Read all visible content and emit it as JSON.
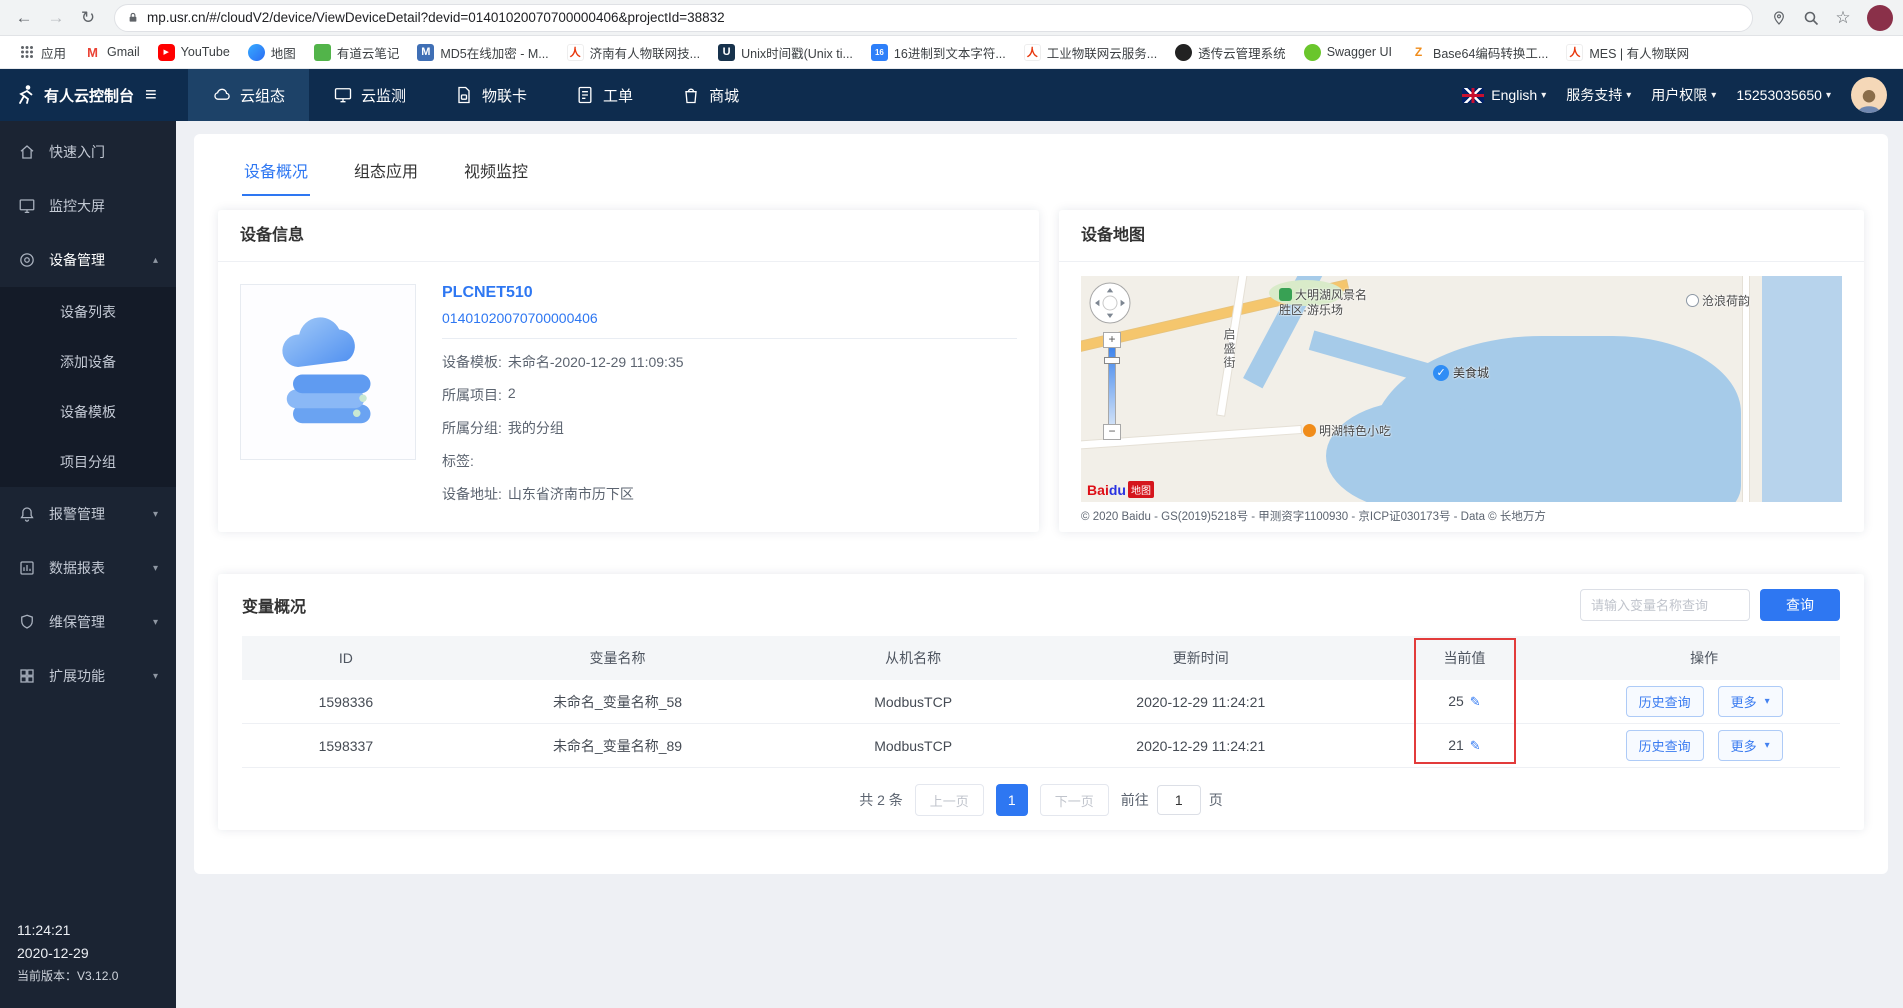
{
  "colors": {
    "accent": "#2e77f2",
    "nav_bg": "#0e2c4e",
    "sidebar_bg": "#1b2433",
    "highlight_red": "#e23b3b",
    "brand_red": "#e8380d"
  },
  "icons": {
    "back": "←",
    "forward": "→",
    "reload": "↻",
    "star": "☆",
    "hamburger": "≡",
    "caret_down": "▾",
    "caret_up": "▴",
    "edit": "✎",
    "check": "✓",
    "zoom_in": "+",
    "zoom_out": "−"
  },
  "browser": {
    "url": "mp.usr.cn/#/cloudV2/device/ViewDeviceDetail?devid=01401020070700000406&projectId=38832",
    "bookmarks": [
      "应用",
      "Gmail",
      "YouTube",
      "地图",
      "有道云笔记",
      "MD5在线加密 - M...",
      "济南有人物联网技...",
      "Unix时间戳(Unix ti...",
      "16进制到文本字符...",
      "工业物联网云服务...",
      "透传云管理系统",
      "Swagger UI",
      "Base64编码转换工...",
      "MES | 有人物联网"
    ],
    "favicon_glyphs": {
      "gmail": "M",
      "play": "▶",
      "md5": "M",
      "person": "人",
      "unix": "U",
      "hex": "16",
      "base64": "Z"
    }
  },
  "topnav": {
    "brand": "有人云控制台",
    "items": [
      {
        "label": "云组态"
      },
      {
        "label": "云监测"
      },
      {
        "label": "物联卡"
      },
      {
        "label": "工单"
      },
      {
        "label": "商城"
      }
    ],
    "language": "English",
    "support": "服务支持",
    "permission": "用户权限",
    "account": "15253035650"
  },
  "sidebar": {
    "items": [
      {
        "label": "快速入门"
      },
      {
        "label": "监控大屏"
      },
      {
        "label": "设备管理"
      },
      {
        "label": "报警管理"
      },
      {
        "label": "数据报表"
      },
      {
        "label": "维保管理"
      },
      {
        "label": "扩展功能"
      }
    ],
    "submenu": [
      "设备列表",
      "添加设备",
      "设备模板",
      "项目分组"
    ],
    "footer": {
      "time": "11:24:21",
      "date": "2020-12-29",
      "version_label": "当前版本：",
      "version": "V3.12.0"
    }
  },
  "main": {
    "tabs": [
      "设备概况",
      "组态应用",
      "视频监控"
    ],
    "device_info": {
      "title": "设备信息",
      "name": "PLCNET510",
      "device_id": "01401020070700000406",
      "fields": [
        {
          "label": "设备模板:",
          "value": "未命名-2020-12-29 11:09:35"
        },
        {
          "label": "所属项目:",
          "value": "2"
        },
        {
          "label": "所属分组:",
          "value": "我的分组"
        },
        {
          "label": "标签:",
          "value": ""
        },
        {
          "label": "设备地址:",
          "value": "山东省济南市历下区"
        }
      ]
    },
    "device_map": {
      "title": "设备地图",
      "pois": {
        "park": "大明湖风景名胜区·游乐场",
        "street": "启盛街",
        "snack": "明湖特色小吃",
        "marker": "美食城",
        "lotus": "沧浪荷韵"
      },
      "logo": {
        "bai": "Bai",
        "du": "du",
        "badge": "地图"
      },
      "copyright": "© 2020 Baidu - GS(2019)5218号 - 甲测资字1100930 - 京ICP证030173号 - Data © 长地万方"
    },
    "variables": {
      "title": "变量概况",
      "search_placeholder": "请输入变量名称查询",
      "search_button": "查询",
      "columns": [
        "ID",
        "变量名称",
        "从机名称",
        "更新时间",
        "当前值",
        "操作"
      ],
      "rows": [
        {
          "id": "1598336",
          "name": "未命名_变量名称_58",
          "slave": "ModbusTCP",
          "updated": "2020-12-29 11:24:21",
          "value": "25"
        },
        {
          "id": "1598337",
          "name": "未命名_变量名称_89",
          "slave": "ModbusTCP",
          "updated": "2020-12-29 11:24:21",
          "value": "21"
        }
      ],
      "actions": {
        "history": "历史查询",
        "more": "更多"
      },
      "pagination": {
        "total": "共 2 条",
        "prev": "上一页",
        "page": "1",
        "next": "下一页",
        "goto_before": "前往",
        "goto_value": "1",
        "goto_after": "页"
      }
    }
  }
}
